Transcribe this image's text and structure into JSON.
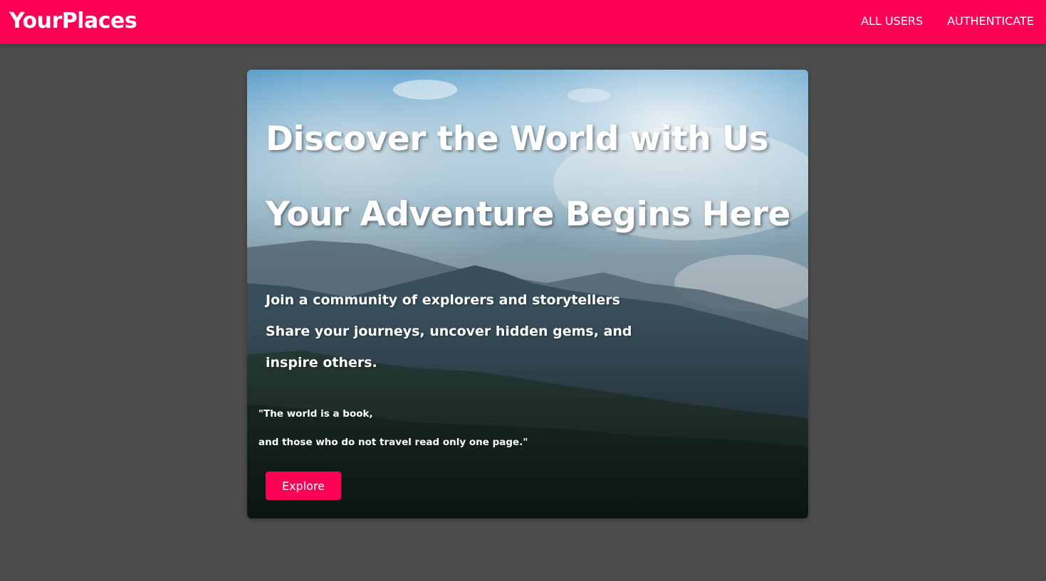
{
  "header": {
    "brand": "YourPlaces",
    "nav": [
      "ALL USERS",
      "AUTHENTICATE"
    ]
  },
  "hero": {
    "title_line_1": "Discover the World with Us",
    "title_line_2": "Your Adventure Begins Here",
    "tagline_lines": [
      "Join a community of explorers and storytellers",
      "Share your journeys, uncover hidden gems, and",
      "inspire others."
    ],
    "quote_lines": [
      "\"The world is a book,",
      "and those who do not travel read only one page.\""
    ],
    "button_label": "Explore",
    "background_image": "mountain-landscape-photo"
  },
  "colors": {
    "accent": "#ff0055",
    "page_background": "#4d4d4d",
    "text_on_accent": "#ffffff"
  }
}
